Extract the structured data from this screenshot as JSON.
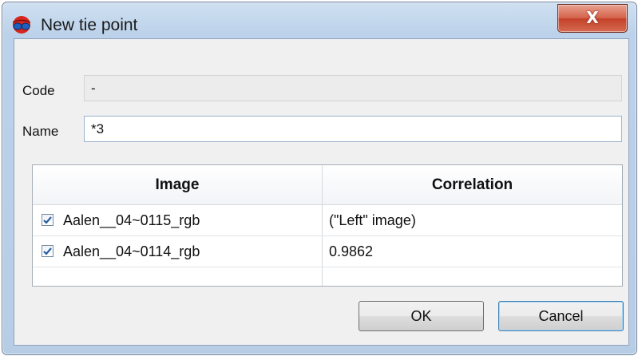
{
  "window": {
    "title": "New tie point",
    "close_glyph": "X",
    "app_icon": "tie-point-glasses-icon"
  },
  "form": {
    "code_label": "Code",
    "code_value": "-",
    "name_label": "Name",
    "name_value": "*3"
  },
  "table": {
    "columns": [
      "Image",
      "Correlation"
    ],
    "rows": [
      {
        "checked": true,
        "image": "Aalen__04~0115_rgb",
        "correlation": "(\"Left\" image)"
      },
      {
        "checked": true,
        "image": "Aalen__04~0114_rgb",
        "correlation": "0.9862"
      }
    ]
  },
  "buttons": {
    "ok_label": "OK",
    "cancel_label": "Cancel"
  },
  "colors": {
    "accent": "#3c7fb1",
    "checkmark": "#2a5f9e",
    "close_button": "#c4412a"
  }
}
